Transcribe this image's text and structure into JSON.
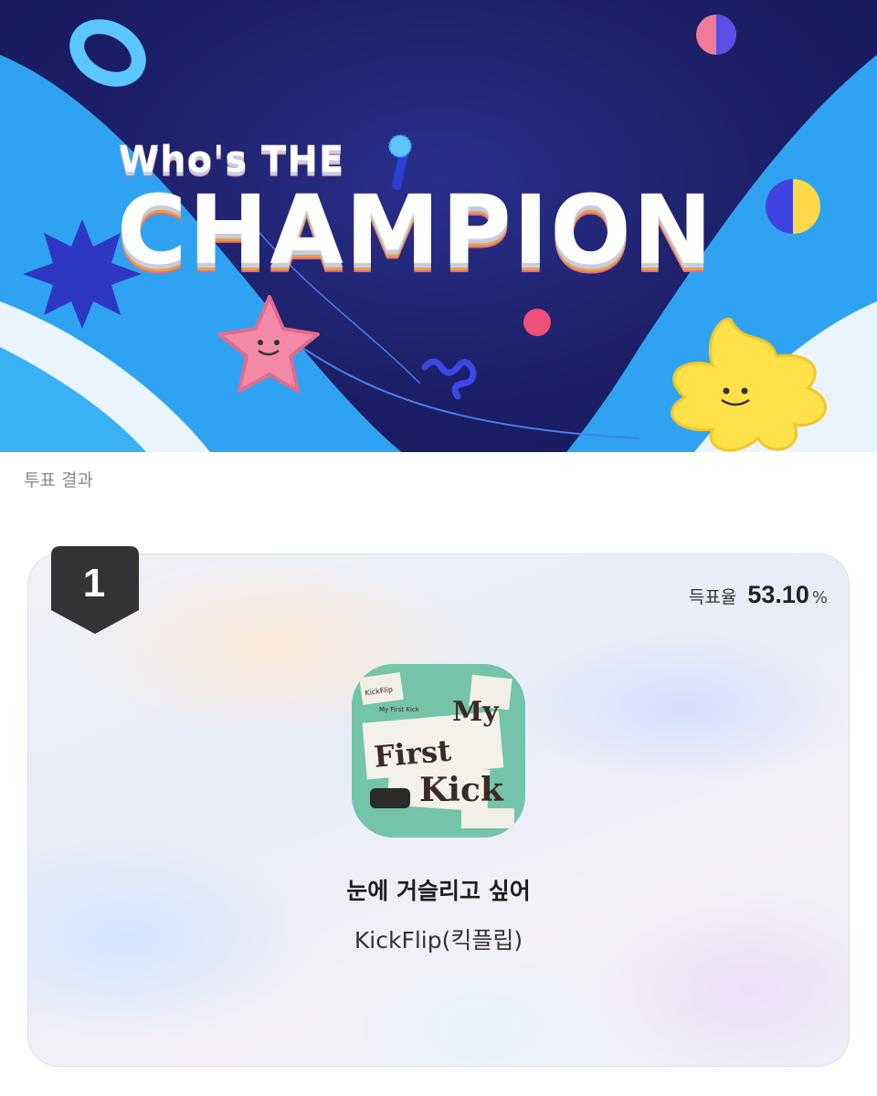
{
  "banner": {
    "title_line1": "Who's THE",
    "title_line2": "CHAMPION"
  },
  "section": {
    "label": "투표 결과"
  },
  "result": {
    "rank": "1",
    "rate_label": "득표율",
    "rate_value": "53.10",
    "rate_unit": "%",
    "vote_share_percent": 53.1,
    "album_art_text": [
      "My",
      "First",
      "Kick",
      "KickFlip",
      "My First Kick"
    ],
    "song_title": "눈에 거슬리고 싶어",
    "artist": "KickFlip(킥플립)"
  },
  "icons": [
    "microphone-icon",
    "rank-badge-icon"
  ],
  "colors": {
    "banner_bg": "#1c1f66",
    "accent_blue": "#2e9ff0",
    "star_pink": "#f07a9a",
    "star_yellow": "#ffe14a",
    "badge": "#333333",
    "album_bg": "#73c4a8"
  }
}
